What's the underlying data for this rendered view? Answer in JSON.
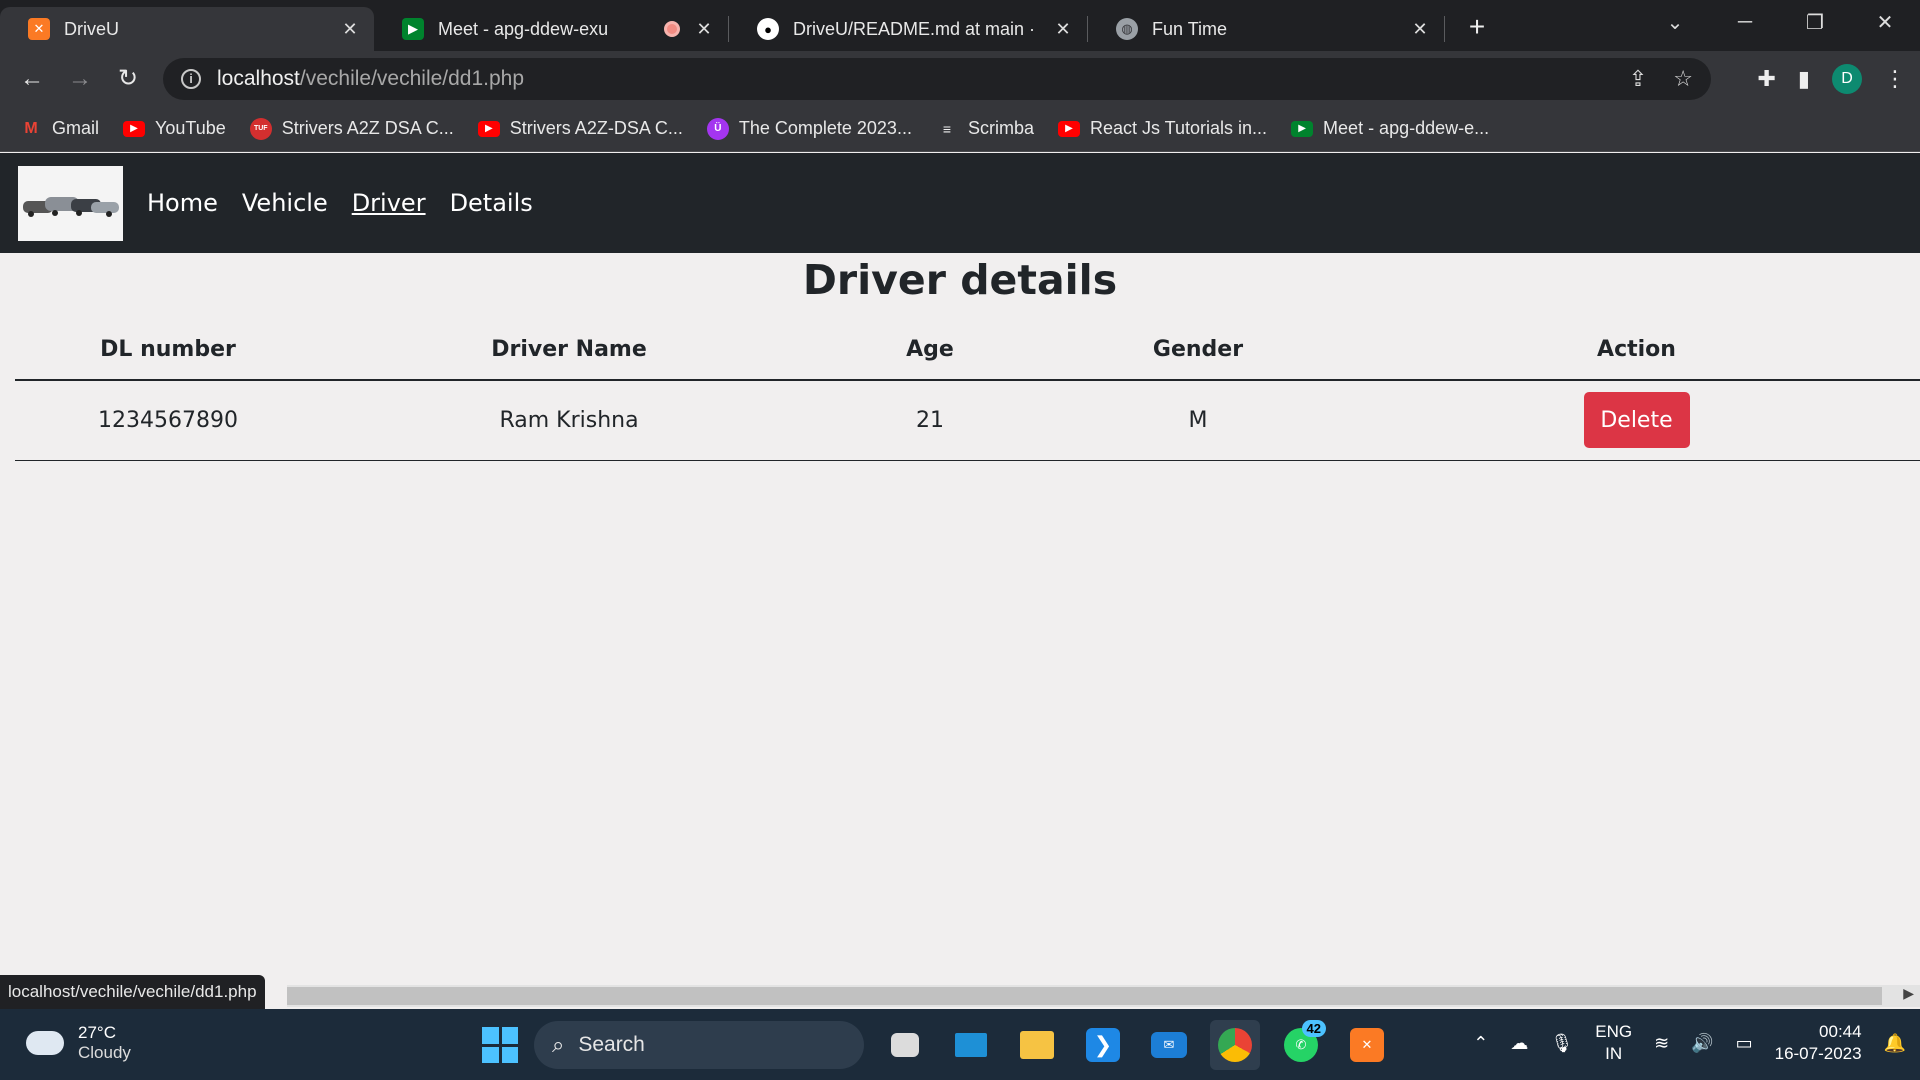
{
  "browser": {
    "tabs": [
      {
        "title": "DriveU",
        "active": true,
        "favicon": "xampp-icon"
      },
      {
        "title": "Meet - apg-ddew-exu",
        "active": false,
        "favicon": "google-meet-icon"
      },
      {
        "title": "DriveU/README.md at main · div",
        "active": false,
        "favicon": "github-icon"
      },
      {
        "title": "Fun Time",
        "active": false,
        "favicon": "globe-icon"
      }
    ],
    "url_host": "localhost",
    "url_path": "/vechile/vechile/dd1.php",
    "profile_initial": "D",
    "bookmarks": [
      "Gmail",
      "YouTube",
      "Strivers A2Z DSA C...",
      "Strivers A2Z-DSA C...",
      "The Complete 2023...",
      "Scrimba",
      "React Js Tutorials in...",
      "Meet - apg-ddew-e..."
    ]
  },
  "nav": {
    "links": [
      "Home",
      "Vehicle",
      "Driver",
      "Details"
    ],
    "active": "Driver"
  },
  "page": {
    "title": "Driver details",
    "columns": [
      "DL number",
      "Driver Name",
      "Age",
      "Gender",
      "Action"
    ],
    "rows": [
      {
        "dl": "1234567890",
        "name": "Ram Krishna",
        "age": "21",
        "gender": "M",
        "action": "Delete"
      }
    ]
  },
  "status_url": "localhost/vechile/vechile/dd1.php",
  "taskbar": {
    "temp": "27°C",
    "weather": "Cloudy",
    "search_placeholder": "Search",
    "whatsapp_badge": "42",
    "lang1": "ENG",
    "lang2": "IN",
    "time": "00:44",
    "date": "16-07-2023"
  },
  "colors": {
    "danger": "#dc3545",
    "navbar": "#212529",
    "accent": "#4cc2ff"
  }
}
